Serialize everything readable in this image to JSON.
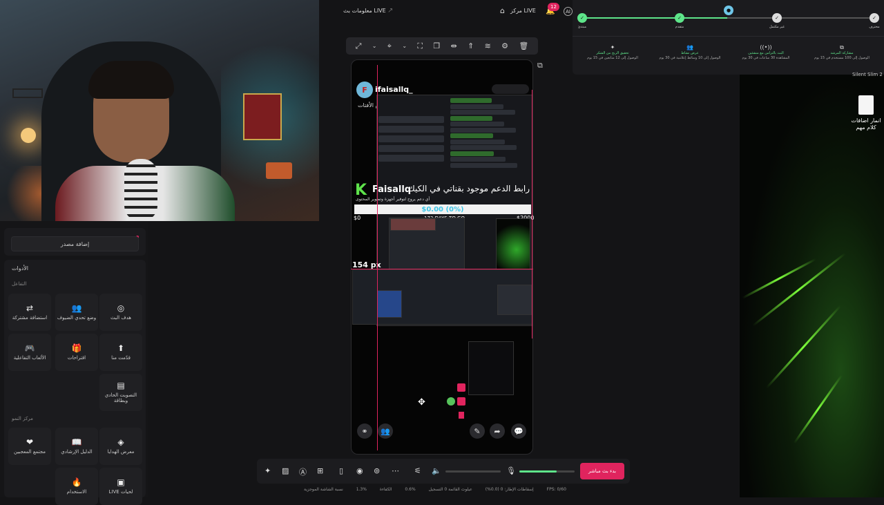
{
  "topbar": {
    "stream_info": "معلومات بث LIVE",
    "live_center": "مركز LIVE",
    "notif_count": "12",
    "ai_label": "AI"
  },
  "progress": {
    "nodes": [
      {
        "label": "مبتدئ",
        "state": "done"
      },
      {
        "label": "متقدم",
        "state": "done"
      },
      {
        "label": "",
        "state": "current"
      },
      {
        "label": "غير مكتمل",
        "state": "todo"
      },
      {
        "label": "محترف",
        "state": "todo"
      }
    ],
    "missions": [
      {
        "title": "تحقيق الربح من الشكر",
        "desc": "الوصول إلى 12 متابعين في 15 يوم"
      },
      {
        "title": "عرض نشاط",
        "desc": "الوصول إلى 10 وسائط إعلامية في 30 يوم"
      },
      {
        "title": "البث بالتزامن مع منشئين",
        "desc": "المشاهدة 30 ساعات في 30 يوم"
      },
      {
        "title": "مشاركة المرشد",
        "desc": "الوصول إلى 100 مستخدم في 15 يوم"
      }
    ]
  },
  "left_panel": {
    "add_source": "إضافة مصدر",
    "tools_title": "الأدوات",
    "interaction_title": "التفاعل",
    "interaction_tools": [
      {
        "label": "هدف البث",
        "icon": "◎"
      },
      {
        "label": "وضع تحدي الضيوف",
        "icon": "👥"
      },
      {
        "label": "استضافة مشتركة",
        "icon": "⇄"
      },
      {
        "label": "قدّمت منا",
        "icon": "⬆"
      },
      {
        "label": "اقتراحات",
        "icon": "🎁"
      },
      {
        "label": "الألعاب التفاعلية",
        "icon": "🎮"
      },
      {
        "label": "التصويت الحادي وبطاقة",
        "icon": "▤"
      }
    ],
    "growth_title": "مركز النمو",
    "growth_tools": [
      {
        "label": "معرض الهدايا",
        "icon": "◈"
      },
      {
        "label": "الدليل الإرشادي",
        "icon": "📖"
      },
      {
        "label": "مجتمع المعجبين",
        "icon": "❤"
      },
      {
        "label": "LIVE لحيات",
        "icon": "▣"
      },
      {
        "label": "الاستخدام",
        "icon": "🔥"
      }
    ]
  },
  "canvas": {
    "username": "ifaisallq_",
    "chat_label": "عروض الأفتات",
    "brand": "Faisallq",
    "support_msg": "رابط الدعم موجود بقناتي في الكيك",
    "sub_msg": "أي دعم يروح لتوفير أجهزة وتطوير المحتوى",
    "goal_text": "$0.00 (0%)",
    "goal_min": "$0",
    "goal_max": "$2000",
    "days_to_go": "173 DAYS TO GO",
    "size_readout": "154 px"
  },
  "bottom": {
    "start_button": "بدء بث مباشر",
    "volume_level": 0.0,
    "mic_level": 0.68,
    "status": {
      "bitrate": "نسبة الشاشة الموجزية",
      "cpu": "1.3%",
      "memory": "0.6%",
      "fps": "FPS: 0/60",
      "drops": "إسقاطات الإطار: 0 (0.0%)",
      "disconnect": "عيلوث القائمة 0 التسجيل",
      "time_label": "الكفاءة"
    }
  },
  "desktop": {
    "file_label": "انمار اضافات كلام مهم",
    "silent_label": "Silent Slim 2"
  },
  "colors": {
    "accent": "#e0245e",
    "progress_green": "#5ee58a",
    "progress_teal": "#6fc6e8"
  }
}
